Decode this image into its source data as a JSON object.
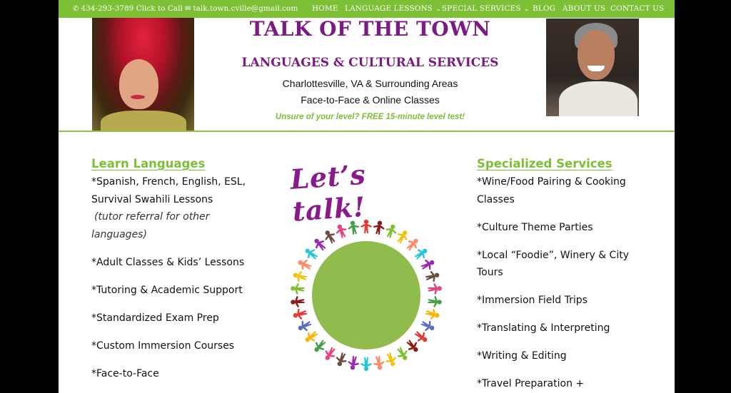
{
  "topbar": {
    "phone": "434-293-3789 Click to Call",
    "email": "talk.town.cville@gmail.com",
    "phone_icon": "phone-icon",
    "email_icon": "envelope-icon"
  },
  "nav": {
    "items": [
      {
        "label": "HOME"
      },
      {
        "label": "LANGUAGE LESSONS",
        "has_dropdown": true
      },
      {
        "label": "SPECIAL SERVICES",
        "has_dropdown": true
      },
      {
        "label": "BLOG"
      },
      {
        "label": "ABOUT US"
      },
      {
        "label": "CONTACT US"
      }
    ]
  },
  "header": {
    "title": "TALK OF THE TOWN",
    "subtitle": "LANGUAGES & CULTURAL SERVICES",
    "location": "Charlottesville, VA & Surrounding Areas",
    "classes": "Face-to-Face & Online Classes",
    "level_test": "Unsure of your level?  FREE 15-minute level test!"
  },
  "left_column": {
    "heading": "Learn Languages",
    "items": [
      "*Spanish, French, English, ESL, Survival Swahili Lessons",
      "*Adult Classes & Kids’ Lessons",
      "*Tutoring & Academic Support",
      "*Standardized Exam Prep",
      "*Custom Immersion Courses",
      "*Face-to-Face"
    ],
    "note": "(tutor referral for other languages)"
  },
  "center": {
    "title": "Let’s talk!"
  },
  "right_column": {
    "heading": "Specialized Services",
    "items": [
      "*Wine/Food Pairing & Cooking Classes",
      "*Culture Theme Parties",
      "*Local “Foodie”, Winery & City Tours",
      "*Immersion Field Trips",
      "*Translating & Interpreting",
      "*Writing & Editing",
      "*Travel Preparation +"
    ]
  },
  "colors": {
    "accent_green": "#7dbf35",
    "brand_purple": "#7a1a83",
    "globe_green": "#8fbc4c"
  }
}
